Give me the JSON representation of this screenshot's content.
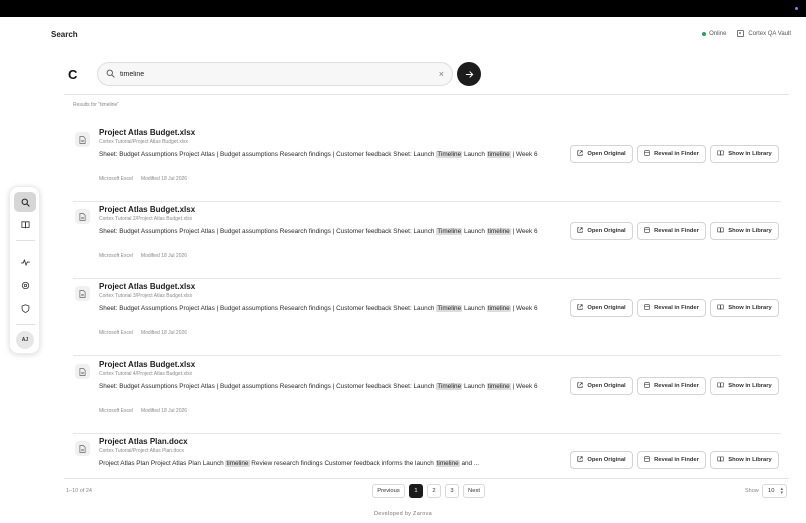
{
  "header": {
    "title": "Search",
    "status": "Online",
    "vault": "Cortex QA Vault"
  },
  "brand": {
    "logo": "C"
  },
  "search": {
    "value": "timeline",
    "placeholder": "",
    "clear_glyph": "×",
    "results_for": "Results for \"timeline\""
  },
  "sidebar": {
    "items": [
      {
        "name": "search-icon",
        "active": true
      },
      {
        "name": "book-icon",
        "active": false
      },
      {
        "name": "activity-icon",
        "active": false
      },
      {
        "name": "settings-icon",
        "active": false
      },
      {
        "name": "shield-icon",
        "active": false
      }
    ],
    "avatar": "AJ"
  },
  "actions": {
    "open": "Open Original",
    "reveal": "Reveal in Finder",
    "library": "Show in Library"
  },
  "results": [
    {
      "title": "Project Atlas Budget.xlsx",
      "path": "Cortex Tutorial/Project Atlas Budget.xlsx",
      "snippet": [
        {
          "t": "Sheet: Budget Assumptions Project Atlas | Budget assumptions Research findings | Customer feedback Sheet: Launch "
        },
        {
          "t": "Timeline",
          "hl": true
        },
        {
          "t": " Launch "
        },
        {
          "t": "timeline",
          "hl": true
        },
        {
          "t": " | Week 6"
        }
      ],
      "app": "Microsoft Excel",
      "modified": "Modified 18 Jul 2026"
    },
    {
      "title": "Project Atlas Budget.xlsx",
      "path": "Cortex Tutorial 2/Project Atlas Budget.xlsx",
      "snippet": [
        {
          "t": "Sheet: Budget Assumptions Project Atlas | Budget assumptions Research findings | Customer feedback Sheet: Launch "
        },
        {
          "t": "Timeline",
          "hl": true
        },
        {
          "t": " Launch "
        },
        {
          "t": "timeline",
          "hl": true
        },
        {
          "t": " | Week 6"
        }
      ],
      "app": "Microsoft Excel",
      "modified": "Modified 18 Jul 2026"
    },
    {
      "title": "Project Atlas Budget.xlsx",
      "path": "Cortex Tutorial 3/Project Atlas Budget.xlsx",
      "snippet": [
        {
          "t": "Sheet: Budget Assumptions Project Atlas | Budget assumptions Research findings | Customer feedback Sheet: Launch "
        },
        {
          "t": "Timeline",
          "hl": true
        },
        {
          "t": " Launch "
        },
        {
          "t": "timeline",
          "hl": true
        },
        {
          "t": " | Week 6"
        }
      ],
      "app": "Microsoft Excel",
      "modified": "Modified 18 Jul 2026"
    },
    {
      "title": "Project Atlas Budget.xlsx",
      "path": "Cortex Tutorial 4/Project Atlas Budget.xlsx",
      "snippet": [
        {
          "t": "Sheet: Budget Assumptions Project Atlas | Budget assumptions Research findings | Customer feedback Sheet: Launch "
        },
        {
          "t": "Timeline",
          "hl": true
        },
        {
          "t": " Launch "
        },
        {
          "t": "timeline",
          "hl": true
        },
        {
          "t": " | Week 6"
        }
      ],
      "app": "Microsoft Excel",
      "modified": "Modified 18 Jul 2026"
    },
    {
      "title": "Project Atlas Plan.docx",
      "path": "Cortex Tutorial/Project Atlas Plan.docx",
      "snippet": [
        {
          "t": "Project Atlas Plan Project Atlas Plan Launch "
        },
        {
          "t": "timeline",
          "hl": true
        },
        {
          "t": " Review research findings Customer feedback informs the launch "
        },
        {
          "t": "timeline",
          "hl": true
        },
        {
          "t": " and ..."
        }
      ],
      "app": "",
      "modified": ""
    }
  ],
  "pagination": {
    "count": "1–10 of 24",
    "previous": "Previous",
    "pages": [
      "1",
      "2",
      "3"
    ],
    "current": "1",
    "next": "Next",
    "show_label": "Show",
    "show_value": "10"
  },
  "footer": {
    "developed": "Developed by Zarova"
  },
  "colors": {
    "accent": "#1c1c1c",
    "online": "#2e9e5a",
    "highlight": "#dcdcdc"
  }
}
